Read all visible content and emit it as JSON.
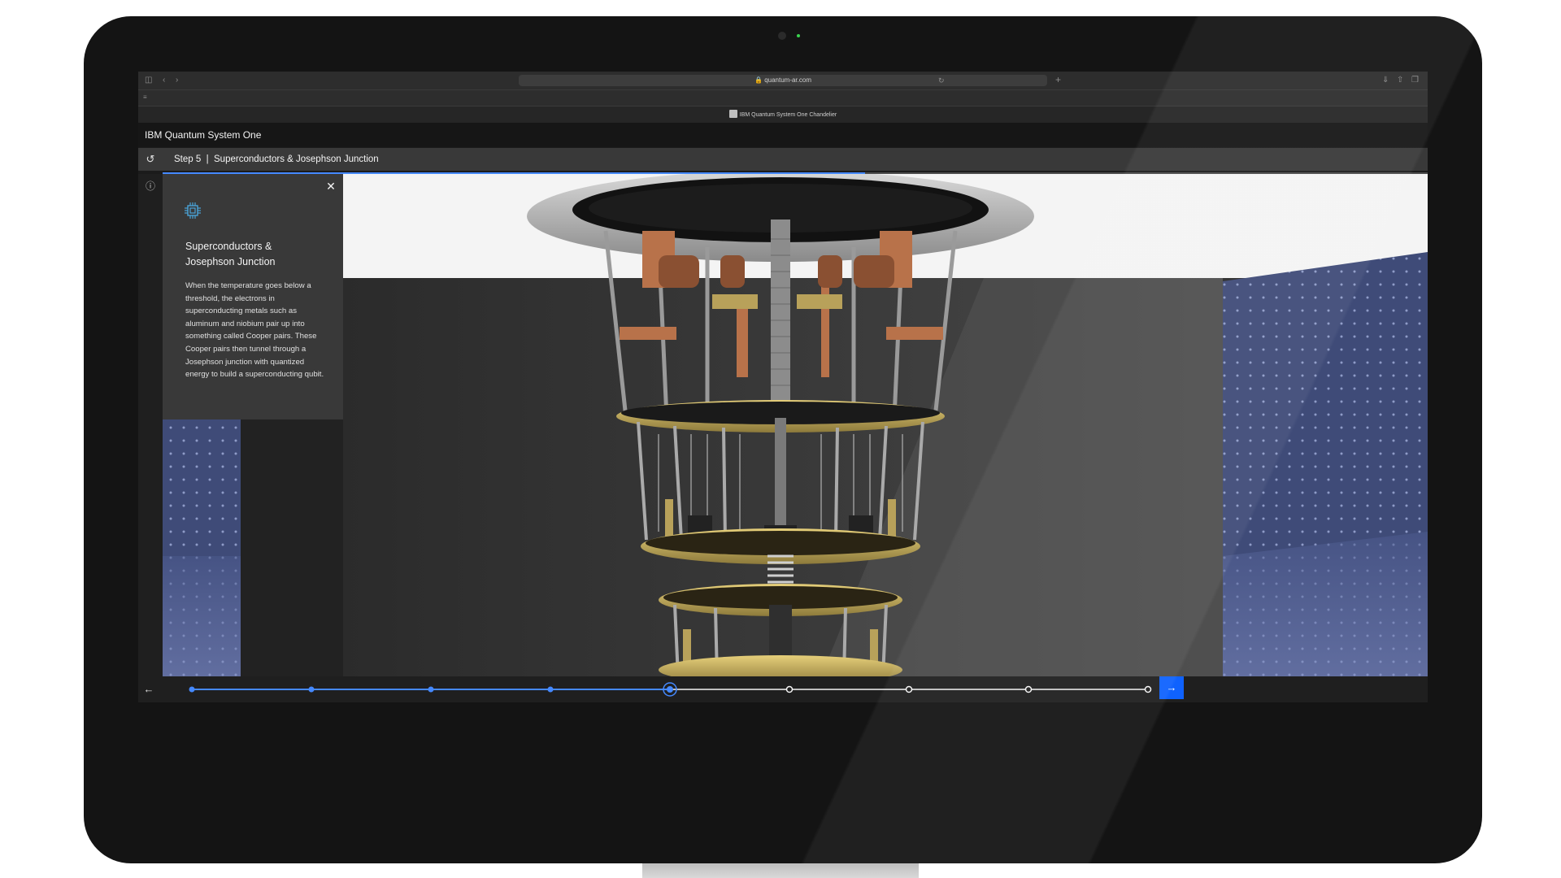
{
  "browser": {
    "url": "quantum-ar.com",
    "tab_title": "IBM Quantum System One Chandelier"
  },
  "app": {
    "title": "IBM Quantum System One"
  },
  "step": {
    "label": "Step 5  |  Superconductors & Josephson Junction",
    "current": 5,
    "total": 9
  },
  "panel": {
    "icon": "chip-icon",
    "title_line1": "Superconductors &",
    "title_line2": "Josephson Junction",
    "body": "When the temperature goes below a threshold, the electrons in superconducting metals such as aluminum and niobium pair up into something called Cooper pairs. These Cooper pairs then tunnel through a Josephson junction with quantized energy to build a superconducting qubit."
  },
  "colors": {
    "accent": "#0f62fe",
    "accent_light": "#4589ff",
    "panel_bg": "#393939",
    "header_bg": "#161616"
  },
  "icons": {
    "reset": "reset-icon",
    "info": "info-icon",
    "close": "close-icon",
    "prev": "arrow-left-icon",
    "next": "arrow-right-icon"
  }
}
